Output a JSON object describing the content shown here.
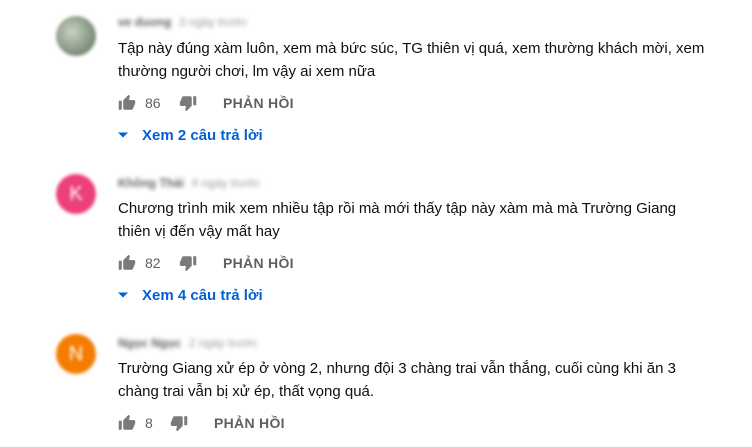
{
  "comments": [
    {
      "avatar_letter": "",
      "avatar_color": "#8a9a86",
      "author": "ve duong",
      "time": "3 ngày trước",
      "text": "Tập này đúng xàm luôn, xem mà bức súc, TG thiên vị quá, xem thường khách mời, xem\nthường người chơi, lm vậy ai xem nữa",
      "likes": "86",
      "reply_label": "PHẢN HỒI",
      "view_replies": "Xem 2 câu trả lời"
    },
    {
      "avatar_letter": "K",
      "avatar_color": "#ec407a",
      "author": "Không Thái",
      "time": "4 ngày trước",
      "text": "Chương trình mik xem nhiều tập rồi mà mới thấy tập này xàm mà mà Trường Giang\nthiên vị đến vậy mất hay",
      "likes": "82",
      "reply_label": "PHẢN HỒI",
      "view_replies": "Xem 4 câu trả lời"
    },
    {
      "avatar_letter": "N",
      "avatar_color": "#f57c00",
      "author": "Ngọc Ngọc",
      "time": "2 ngày trước",
      "text": "Trường Giang xử ép ở vòng 2, nhưng đội 3 chàng trai vẫn thắng, cuối cùng khi ăn 3\nchàng trai vẫn bị xử ép, thất vọng quá.",
      "likes": "8",
      "reply_label": "PHẢN HỒI"
    }
  ],
  "icons": {
    "like": "thumb-up-icon",
    "dislike": "thumb-down-icon",
    "expand": "caret-down-icon"
  }
}
